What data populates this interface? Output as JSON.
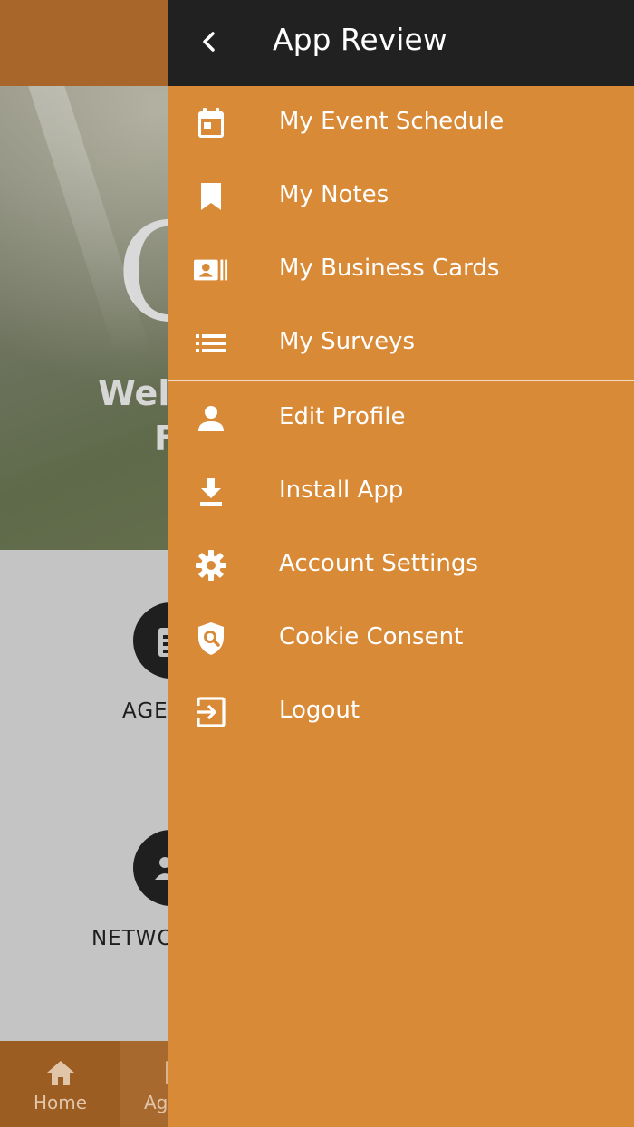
{
  "background": {
    "hero": {
      "logo_letter": "C",
      "welcome": "Wel",
      "sub": "F"
    },
    "tiles": [
      {
        "label": "AGE",
        "icon": "agenda-icon"
      },
      {
        "label": "NETWO",
        "icon": "people-icon"
      }
    ],
    "bottom_nav": [
      {
        "label": "Home",
        "icon": "home-icon"
      },
      {
        "label": "Ag",
        "icon": "agenda-icon"
      }
    ]
  },
  "drawer": {
    "title": "App Review",
    "back_icon": "chevron-left-icon",
    "items": [
      {
        "label": "My Event Schedule",
        "icon": "calendar-icon"
      },
      {
        "label": "My Notes",
        "icon": "bookmark-icon"
      },
      {
        "label": "My Business Cards",
        "icon": "business-card-icon"
      },
      {
        "label": "My Surveys",
        "icon": "list-icon"
      },
      {
        "label": "Edit Profile",
        "icon": "person-icon"
      },
      {
        "label": "Install App",
        "icon": "download-icon"
      },
      {
        "label": "Account Settings",
        "icon": "gear-icon"
      },
      {
        "label": "Cookie Consent",
        "icon": "shield-search-icon"
      },
      {
        "label": "Logout",
        "icon": "logout-icon"
      }
    ]
  },
  "colors": {
    "drawer_bg": "#d98a37",
    "drawer_header": "#212121",
    "page_header": "#a9662a"
  }
}
